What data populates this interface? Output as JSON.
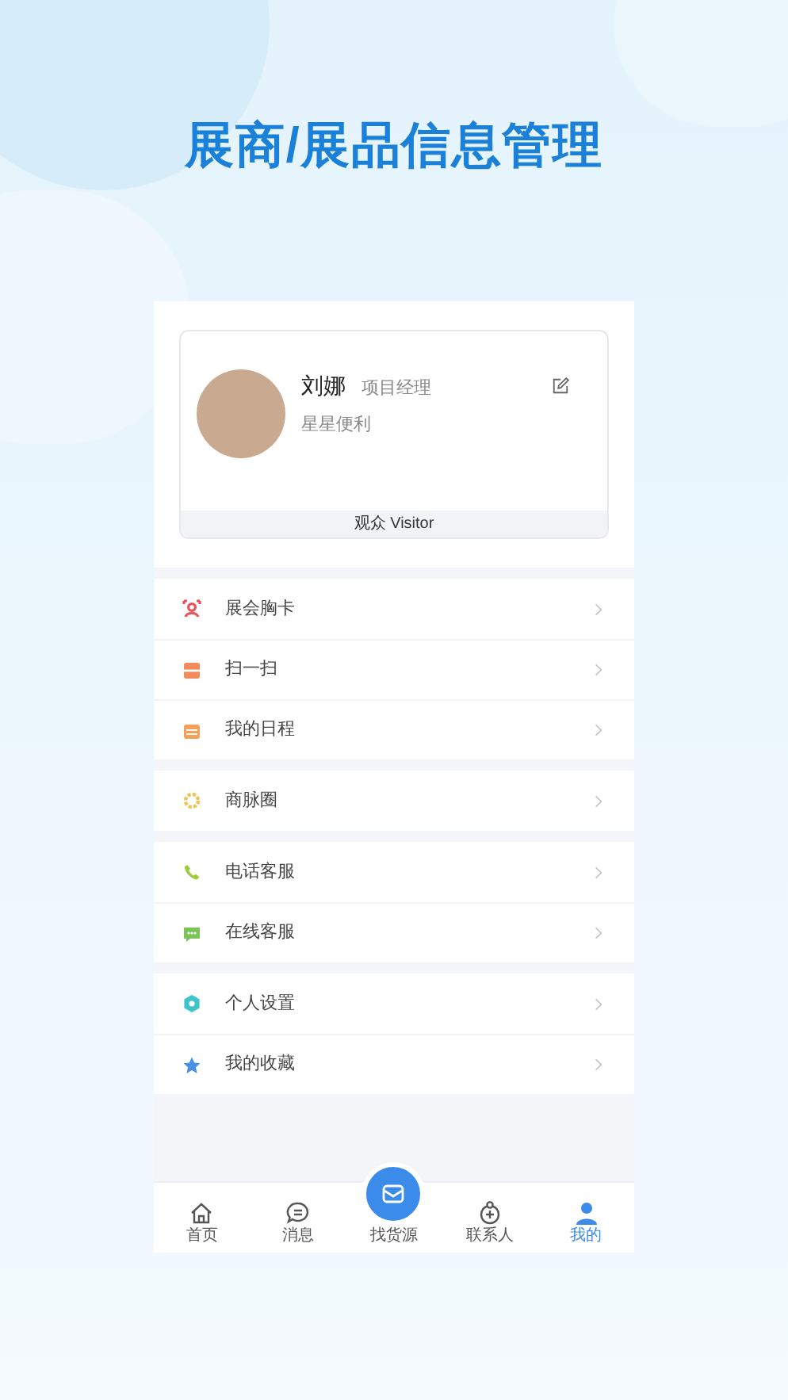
{
  "headline": "展商/展品信息管理",
  "profile": {
    "name": "刘娜",
    "title": "项目经理",
    "company": "星星便利",
    "role": "观众 Visitor"
  },
  "menu_groups": [
    {
      "items": [
        {
          "label": "展会胸卡",
          "kind": "badge",
          "color": "#e8525a"
        },
        {
          "label": "扫一扫",
          "kind": "scan",
          "color": "#f28a5a"
        },
        {
          "label": "我的日程",
          "kind": "calendar",
          "color": "#f2a05a"
        }
      ]
    },
    {
      "items": [
        {
          "label": "商脉圈",
          "kind": "circle",
          "color": "#f2c24a"
        }
      ]
    },
    {
      "items": [
        {
          "label": "电话客服",
          "kind": "phone",
          "color": "#9ccc3a"
        },
        {
          "label": "在线客服",
          "kind": "chat",
          "color": "#7cc45a"
        }
      ]
    },
    {
      "items": [
        {
          "label": "个人设置",
          "kind": "gear",
          "color": "#3ec4c8"
        },
        {
          "label": "我的收藏",
          "kind": "star",
          "color": "#4a90e2"
        }
      ]
    }
  ],
  "tab_bar": [
    {
      "label": "首页",
      "kind": "plain",
      "selected": false
    },
    {
      "label": "消息",
      "kind": "plain",
      "selected": false
    },
    {
      "label": "找货源",
      "kind": "raised",
      "selected": false
    },
    {
      "label": "联系人",
      "kind": "plain",
      "selected": false
    },
    {
      "label": "我的",
      "kind": "plain",
      "selected": true
    }
  ]
}
